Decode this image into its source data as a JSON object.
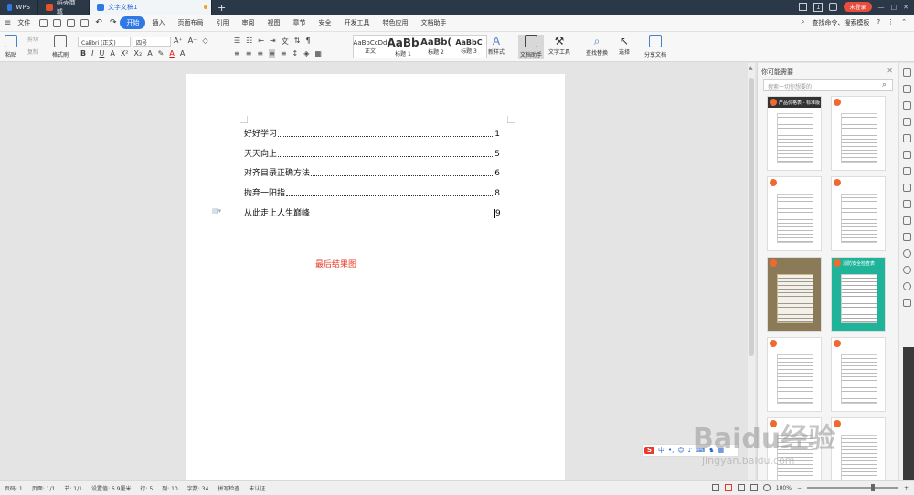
{
  "tabs": {
    "wps": "WPS",
    "store": "稻壳商城",
    "doc": "文字文稿1",
    "new": "+"
  },
  "window": {
    "page_number_badge": "1",
    "login": "未登录"
  },
  "menu": {
    "file": "文件",
    "items": [
      "开始",
      "插入",
      "页面布局",
      "引用",
      "审阅",
      "视图",
      "章节",
      "安全",
      "开发工具",
      "特色应用",
      "文档助手"
    ],
    "search": "查找命令、搜索模板",
    "help": "?"
  },
  "ribbon": {
    "paste": "粘贴",
    "cut": "剪切",
    "copy": "复制",
    "format_painter": "格式刷",
    "font": "Calibri (正文)",
    "size": "四号",
    "styles": [
      {
        "preview": "AaBbCcDd",
        "name": "正文"
      },
      {
        "preview": "AaBb",
        "name": "标题 1"
      },
      {
        "preview": "AaBb(",
        "name": "标题 2"
      },
      {
        "preview": "AaBbC",
        "name": "标题 3"
      }
    ],
    "new_style": "新样式",
    "doc_assistant": "文档助手",
    "text_tools": "文字工具",
    "find_replace": "查找替换",
    "select": "选择",
    "share": "分享文档"
  },
  "document": {
    "toc": [
      {
        "title": "好好学习",
        "page": "1"
      },
      {
        "title": "天天向上",
        "page": "5"
      },
      {
        "title": "对齐目录正确方法",
        "page": "6"
      },
      {
        "title": "抛弃一阳指",
        "page": "8"
      },
      {
        "title": "从此走上人生巅峰",
        "page": "9"
      }
    ],
    "caption": "最后结果图"
  },
  "panel": {
    "title": "你可能需要",
    "search_placeholder": "搜索一切你想要的",
    "templates": [
      "产品价格表 - 标准版",
      "",
      "",
      "",
      "",
      "消防安全检查表",
      "",
      "",
      "",
      ""
    ]
  },
  "status": {
    "page": "页码: 1",
    "pages": "页面: 1/1",
    "section": "节: 1/1",
    "setting": "设置值: 6.9厘米",
    "row": "行: 5",
    "col": "列: 10",
    "words": "字数: 34",
    "spell": "拼写检查",
    "auth": "未认证",
    "zoom": "100%"
  },
  "ime": {
    "logo": "S",
    "lang": "中"
  },
  "watermark": {
    "brand": "Baidu经验",
    "url": "jingyan.baidu.com"
  }
}
